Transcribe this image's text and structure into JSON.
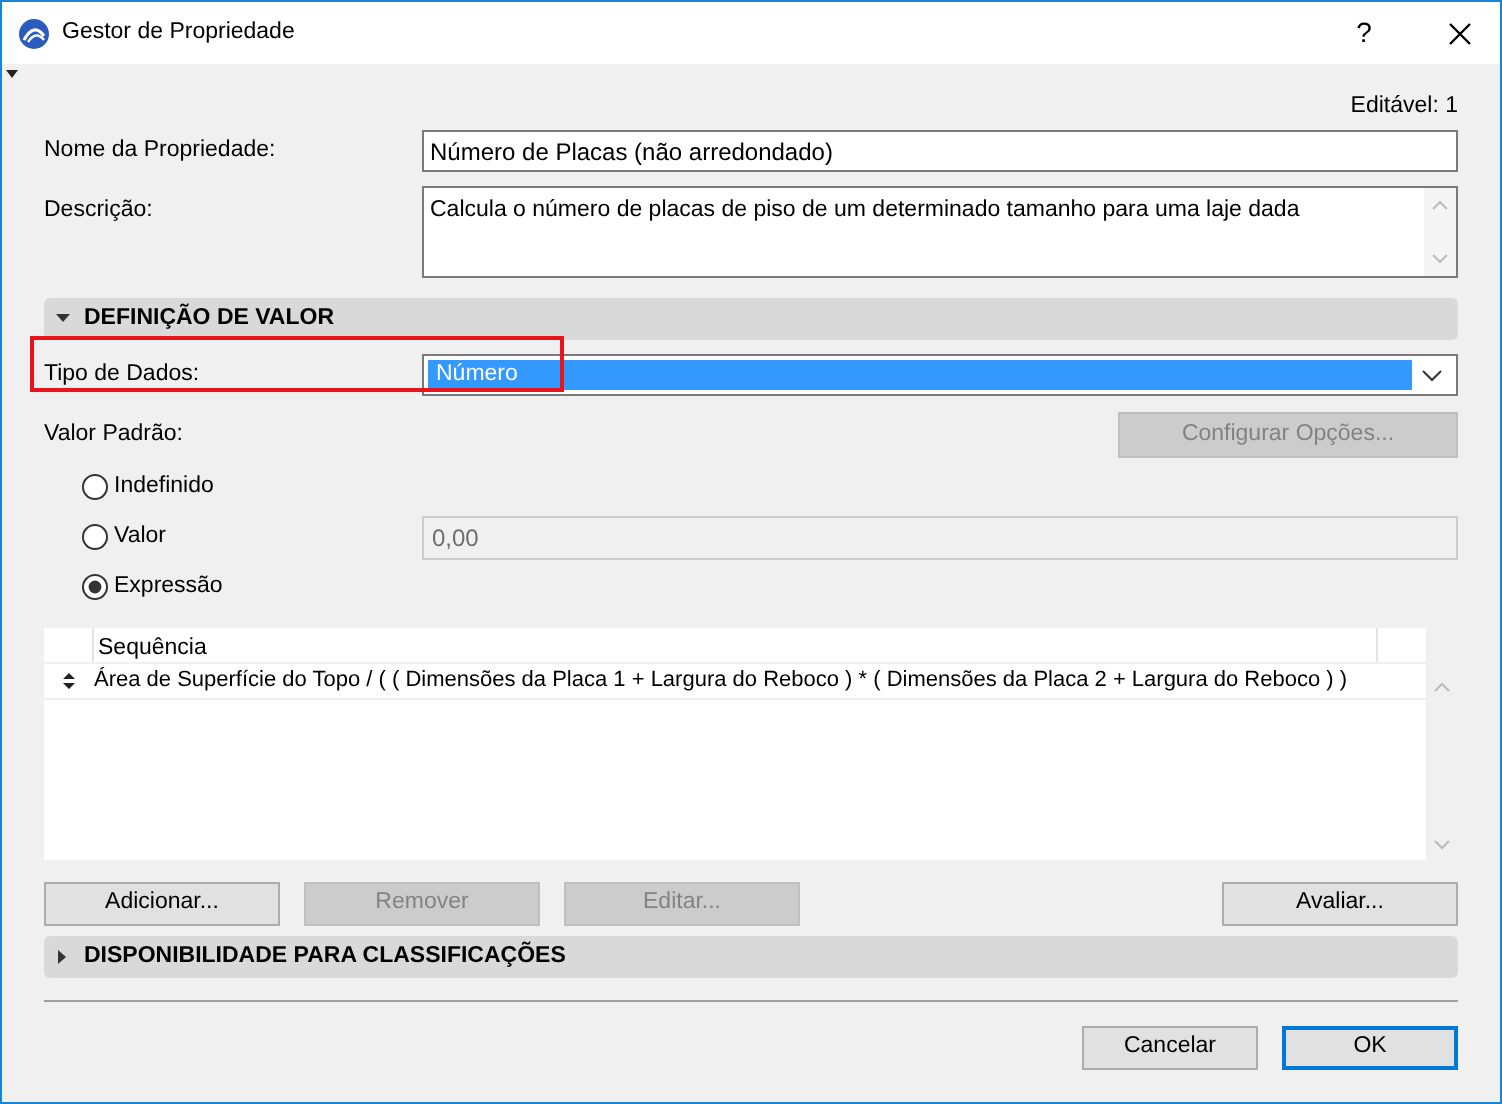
{
  "window": {
    "title": "Gestor de Propriedade",
    "help": "?"
  },
  "editable": "Editável: 1",
  "name_field": {
    "label": "Nome da Propriedade:",
    "value": "Número de Placas (não arredondado)"
  },
  "description_field": {
    "label": "Descrição:",
    "value": "Calcula o número de placas de piso de um determinado tamanho para uma laje dada"
  },
  "value_section": {
    "title": "DEFINIÇÃO DE VALOR",
    "expanded": true,
    "data_type": {
      "label": "Tipo de Dados:",
      "value": "Número",
      "highlighted": true
    },
    "default_label": "Valor Padrão:",
    "configure_button": {
      "label": "Configurar Opções...",
      "disabled": true
    },
    "options": [
      {
        "label": "Indefinido",
        "selected": false
      },
      {
        "label": "Valor",
        "selected": false
      },
      {
        "label": "Expressão",
        "selected": true
      }
    ],
    "value_field": {
      "value": "0,00",
      "disabled": true
    },
    "table": {
      "column": "Sequência",
      "rows": [
        "Área de Superfície do Topo / ( ( Dimensões da Placa 1 + Largura do Reboco ) * ( Dimensões da Placa 2 + Largura do Reboco ) )"
      ]
    },
    "buttons": [
      {
        "label": "Adicionar...",
        "disabled": false
      },
      {
        "label": "Remover",
        "disabled": true
      },
      {
        "label": "Editar...",
        "disabled": true
      },
      {
        "label": "Avaliar...",
        "disabled": false
      }
    ]
  },
  "classification_section": {
    "title": "DISPONIBILIDADE PARA CLASSIFICAÇÕES",
    "expanded": false
  },
  "footer_buttons": [
    {
      "label": "Cancelar",
      "default": false
    },
    {
      "label": "OK",
      "default": true
    }
  ]
}
